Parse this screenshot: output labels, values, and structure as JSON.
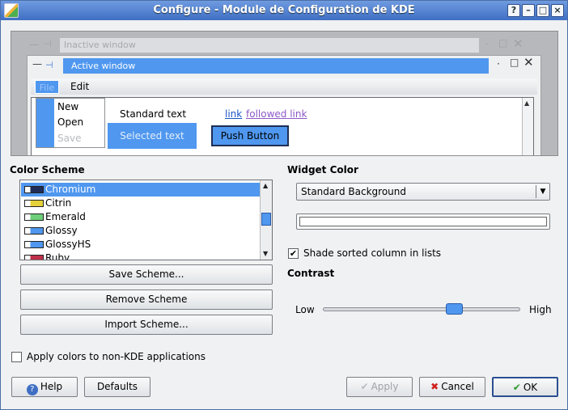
{
  "window": {
    "title": "Configure - Module de Configuration de KDE",
    "controls": {
      "help": "?",
      "minimize": "–",
      "maximize": "□",
      "close": "×"
    }
  },
  "preview": {
    "inactive_title": "Inactive window",
    "active_title": "Active window",
    "menu": {
      "file": "File",
      "edit": "Edit"
    },
    "popup_items": [
      {
        "label": "New",
        "disabled": false
      },
      {
        "label": "Open",
        "disabled": false
      },
      {
        "label": "Save",
        "disabled": true
      }
    ],
    "standard_text": "Standard text",
    "selected_text": "Selected text",
    "link": "link",
    "followed_link": "followed link",
    "push_button": "Push Button"
  },
  "color_scheme": {
    "label": "Color Scheme",
    "items": [
      {
        "name": "Chromium",
        "swatch": "#1f2c55",
        "selected": true
      },
      {
        "name": "Citrin",
        "swatch": "#e6d23a",
        "selected": false
      },
      {
        "name": "Emerald",
        "swatch": "#6fcf7a",
        "selected": false
      },
      {
        "name": "Glossy",
        "swatch": "#4f97ef",
        "selected": false
      },
      {
        "name": "GlossyHS",
        "swatch": "#4f97ef",
        "selected": false
      },
      {
        "name": "Ruby",
        "swatch": "#c0304a",
        "selected": false
      }
    ],
    "save_label": "Save Scheme...",
    "remove_label": "Remove Scheme",
    "import_label": "Import Scheme..."
  },
  "widget_color": {
    "label": "Widget Color",
    "selected": "Standard Background",
    "shade_label": "Shade sorted column in lists",
    "shade_checked": true
  },
  "contrast": {
    "label": "Contrast",
    "low": "Low",
    "high": "High",
    "value": 0.68
  },
  "apply_non_kde": {
    "label": "Apply colors to non-KDE applications",
    "checked": false
  },
  "footer": {
    "help": "Help",
    "defaults": "Defaults",
    "apply": "Apply",
    "cancel": "Cancel",
    "ok": "OK"
  },
  "colors": {
    "accent": "#4f97ef",
    "titlebar": "#3f6fc4"
  }
}
